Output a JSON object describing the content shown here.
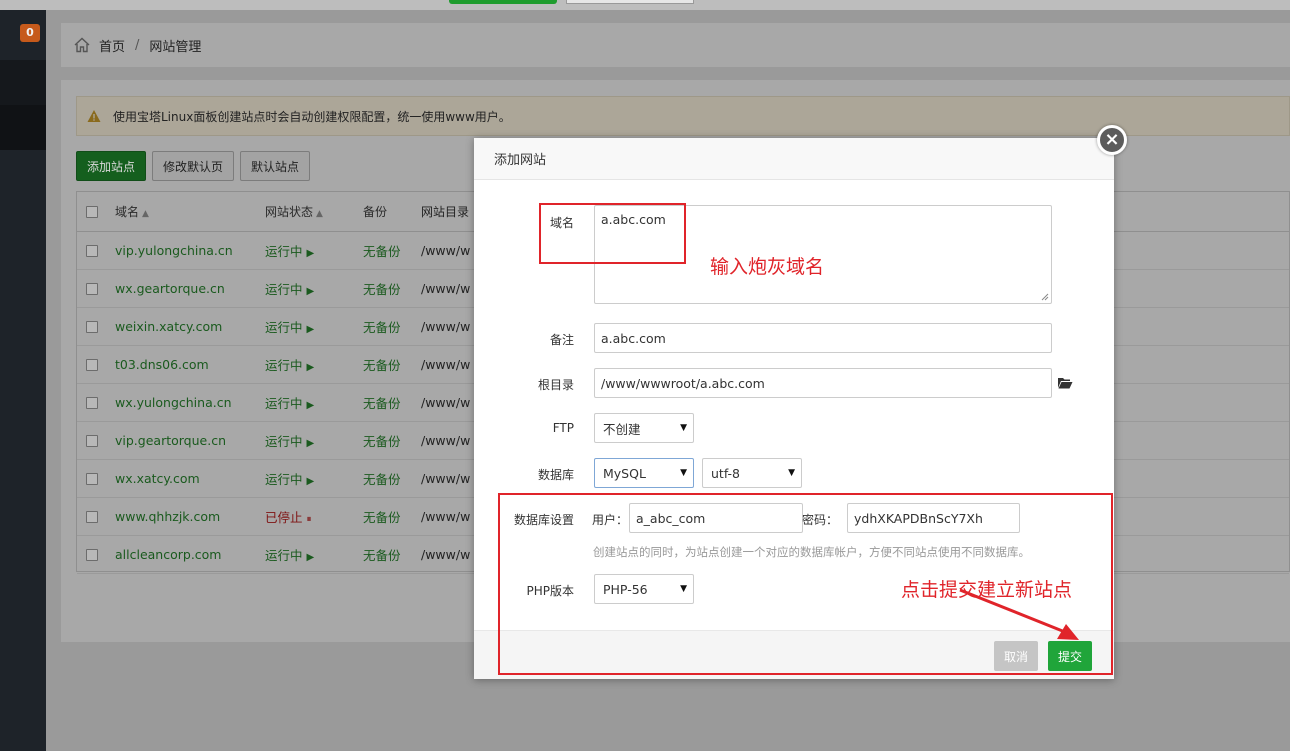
{
  "sidebar": {
    "badge_count": "0"
  },
  "breadcrumb": {
    "home": "首页",
    "separator": "/",
    "current": "网站管理"
  },
  "alert": {
    "text": "使用宝塔Linux面板创建站点时会自动创建权限配置，统一使用www用户。"
  },
  "toolbar": {
    "add_site": "添加站点",
    "edit_default_page": "修改默认页",
    "default_site": "默认站点"
  },
  "table": {
    "headers": {
      "domain": "域名",
      "status": "网站状态",
      "backup": "备份",
      "path": "网站目录"
    },
    "rows": [
      {
        "domain": "vip.yulongchina.cn",
        "status": "运行中",
        "backup": "无备份",
        "path": "/www/w"
      },
      {
        "domain": "wx.geartorque.cn",
        "status": "运行中",
        "backup": "无备份",
        "path": "/www/w"
      },
      {
        "domain": "weixin.xatcy.com",
        "status": "运行中",
        "backup": "无备份",
        "path": "/www/w"
      },
      {
        "domain": "t03.dns06.com",
        "status": "运行中",
        "backup": "无备份",
        "path": "/www/w"
      },
      {
        "domain": "wx.yulongchina.cn",
        "status": "运行中",
        "backup": "无备份",
        "path": "/www/w"
      },
      {
        "domain": "vip.geartorque.cn",
        "status": "运行中",
        "backup": "无备份",
        "path": "/www/w"
      },
      {
        "domain": "wx.xatcy.com",
        "status": "运行中",
        "backup": "无备份",
        "path": "/www/w"
      },
      {
        "domain": "www.qhhzjk.com",
        "status": "已停止",
        "backup": "无备份",
        "path": "/www/w",
        "stopped": true
      },
      {
        "domain": "allcleancorp.com",
        "status": "运行中",
        "backup": "无备份",
        "path": "/www/w"
      }
    ]
  },
  "modal": {
    "title": "添加网站",
    "close_glyph": "×",
    "domain_label": "域名",
    "domain_value": "a.abc.com",
    "note_label": "备注",
    "note_value": "a.abc.com",
    "root_label": "根目录",
    "root_value": "/www/wwwroot/a.abc.com",
    "ftp_label": "FTP",
    "ftp_value": "不创建",
    "db_label": "数据库",
    "db_value": "MySQL",
    "charset_value": "utf-8",
    "db_settings_label": "数据库设置",
    "user_label": "用户：",
    "user_value": "a_abc_com",
    "password_label": "密码：",
    "password_value": "ydhXKAPDBnScY7Xh",
    "db_hint": "创建站点的同时，为站点创建一个对应的数据库帐户，方便不同站点使用不同数据库。",
    "php_label": "PHP版本",
    "php_value": "PHP-56",
    "cancel": "取消",
    "submit": "提交"
  },
  "annotations": {
    "domain_note": "输入炮灰域名",
    "submit_note": "点击提交建立新站点"
  },
  "colors": {
    "accent_green": "#20a53a",
    "annotation_red": "#e0242a"
  }
}
